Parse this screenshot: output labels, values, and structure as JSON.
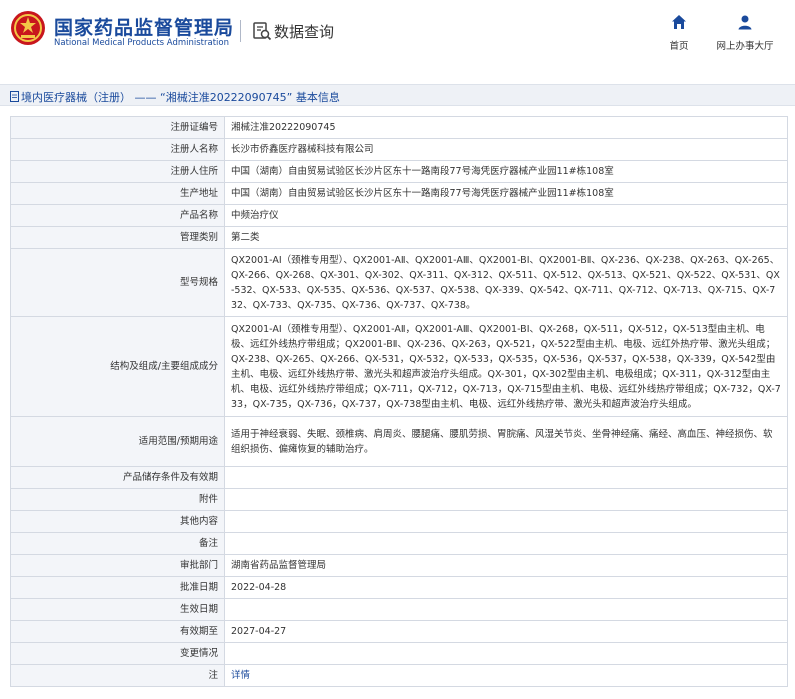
{
  "header": {
    "logo_cn": "国家药品监督管理局",
    "logo_en": "National Medical Products Administration",
    "query_title": "数据查询",
    "nav": [
      {
        "label": "首页",
        "icon": "home-icon"
      },
      {
        "label": "网上办事大厅",
        "icon": "user-icon"
      }
    ]
  },
  "breadcrumb": {
    "text": "境内医疗器械（注册） —— “湘械注准20222090745” 基本信息"
  },
  "colors": {
    "brand_blue": "#1a4a9c",
    "label_bg": "#f3f5f9",
    "border": "#d4d9e2",
    "crumb_bg": "#eef1f6"
  },
  "record": [
    {
      "label": "注册证编号",
      "value": "湘械注准20222090745"
    },
    {
      "label": "注册人名称",
      "value": "长沙市侨鑫医疗器械科技有限公司"
    },
    {
      "label": "注册人住所",
      "value": "中国（湖南）自由贸易试验区长沙片区东十一路南段77号海凭医疗器械产业园11#栋108室"
    },
    {
      "label": "生产地址",
      "value": "中国（湖南）自由贸易试验区长沙片区东十一路南段77号海凭医疗器械产业园11#栋108室"
    },
    {
      "label": "产品名称",
      "value": "中频治疗仪"
    },
    {
      "label": "管理类别",
      "value": "第二类"
    },
    {
      "label": "型号规格",
      "value": "QX2001-AI（颈椎专用型）、QX2001-AⅡ、QX2001-AⅢ、QX2001-BI、QX2001-BⅡ、QX-236、QX-238、QX-263、QX-265、QX-266、QX-268、QX-301、QX-302、QX-311、QX-312、QX-511、QX-512、QX-513、QX-521、QX-522、QX-531、QX-532、QX-533、QX-535、QX-536、QX-537、QX-538、QX-339、QX-542、QX-711、QX-712、QX-713、QX-715、QX-732、QX-733、QX-735、QX-736、QX-737、QX-738。"
    },
    {
      "label": "结构及组成/主要组成成分",
      "value": "QX2001-AI（颈椎专用型）、QX2001-AⅡ，QX2001-AⅢ、QX2001-BI、QX-268，QX-511，QX-512，QX-513型由主机、电极、远红外线热疗带组成；QX2001-BⅡ、QX-236、QX-263，QX-521，QX-522型由主机、电极、远红外热疗带、激光头组成；QX-238、QX-265、QX-266、QX-531，QX-532，QX-533，QX-535，QX-536，QX-537，QX-538，QX-339，QX-542型由主机、电极、远红外线热疗带、激光头和超声波治疗头组成。QX-301，QX-302型由主机、电极组成；QX-311，QX-312型由主机、电极、远红外线热疗带组成；QX-711，QX-712，QX-713，QX-715型由主机、电极、远红外线热疗带组成；QX-732，QX-733，QX-735，QX-736，QX-737，QX-738型由主机、电极、远红外线热疗带、激光头和超声波治疗头组成。"
    },
    {
      "label": "适用范围/预期用途",
      "value": "适用于神经衰弱、失眠、颈椎病、肩周炎、腰腿痛、腰肌劳损、胃脘痛、风湿关节炎、坐骨神经痛、痛经、高血压、神经损伤、软组织损伤、偏瘫恢复的辅助治疗。"
    },
    {
      "label": "产品储存条件及有效期",
      "value": ""
    },
    {
      "label": "附件",
      "value": ""
    },
    {
      "label": "其他内容",
      "value": ""
    },
    {
      "label": "备注",
      "value": ""
    },
    {
      "label": "审批部门",
      "value": "湖南省药品监督管理局"
    },
    {
      "label": "批准日期",
      "value": "2022-04-28"
    },
    {
      "label": "生效日期",
      "value": ""
    },
    {
      "label": "有效期至",
      "value": "2027-04-27"
    },
    {
      "label": "变更情况",
      "value": ""
    },
    {
      "label": "注",
      "value": "详情",
      "is_link": true
    }
  ]
}
